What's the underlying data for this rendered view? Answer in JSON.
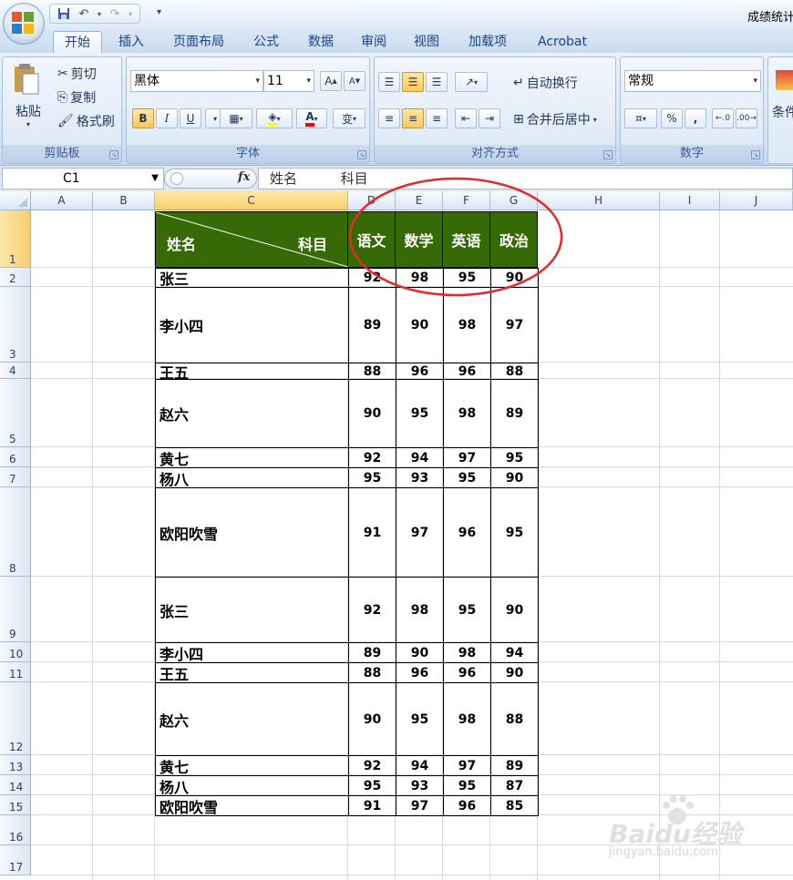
{
  "title_bar": {
    "doc_title": "成绩统计"
  },
  "tabs": [
    "开始",
    "插入",
    "页面布局",
    "公式",
    "数据",
    "审阅",
    "视图",
    "加载项",
    "Acrobat"
  ],
  "ribbon": {
    "clipboard": {
      "label": "剪贴板",
      "paste": "粘贴",
      "cut": "剪切",
      "copy": "复制",
      "format_painter": "格式刷"
    },
    "font": {
      "label": "字体",
      "font_name": "黑体",
      "font_size": "11",
      "bold": "B",
      "italic": "I",
      "underline": "U",
      "phonetic": "变"
    },
    "alignment": {
      "label": "对齐方式",
      "wrap_text": "自动换行",
      "merge_center": "合并后居中"
    },
    "number": {
      "label": "数字",
      "format": "常规",
      "percent": "%",
      "comma": ","
    },
    "styles": {
      "cond_format": "条件"
    }
  },
  "formula_bar": {
    "name_box": "C1",
    "fx": "fx",
    "content": "姓名          科目"
  },
  "columns": [
    "A",
    "B",
    "C",
    "D",
    "E",
    "F",
    "G",
    "H",
    "I",
    "J"
  ],
  "rows": [
    "1",
    "2",
    "3",
    "4",
    "5",
    "6",
    "7",
    "8",
    "9",
    "10",
    "11",
    "12",
    "13",
    "14",
    "15",
    "16",
    "17"
  ],
  "table": {
    "header_name": "姓名",
    "header_subject": "科目",
    "subjects": [
      "语文",
      "数学",
      "英语",
      "政治"
    ],
    "records": [
      {
        "name": "张三",
        "scores": [
          "92",
          "98",
          "95",
          "90"
        ]
      },
      {
        "name": "李小四",
        "scores": [
          "89",
          "90",
          "98",
          "97"
        ]
      },
      {
        "name": "王五",
        "scores": [
          "88",
          "96",
          "96",
          "88"
        ]
      },
      {
        "name": "赵六",
        "scores": [
          "90",
          "95",
          "98",
          "89"
        ]
      },
      {
        "name": "黄七",
        "scores": [
          "92",
          "94",
          "97",
          "95"
        ]
      },
      {
        "name": "杨八",
        "scores": [
          "95",
          "93",
          "95",
          "90"
        ]
      },
      {
        "name": "欧阳吹雪",
        "scores": [
          "91",
          "97",
          "96",
          "95"
        ]
      },
      {
        "name": "张三",
        "scores": [
          "92",
          "98",
          "95",
          "90"
        ]
      },
      {
        "name": "李小四",
        "scores": [
          "89",
          "90",
          "98",
          "94"
        ]
      },
      {
        "name": "王五",
        "scores": [
          "88",
          "96",
          "96",
          "90"
        ]
      },
      {
        "name": "赵六",
        "scores": [
          "90",
          "95",
          "98",
          "88"
        ]
      },
      {
        "name": "黄七",
        "scores": [
          "92",
          "94",
          "97",
          "89"
        ]
      },
      {
        "name": "杨八",
        "scores": [
          "95",
          "93",
          "95",
          "87"
        ]
      },
      {
        "name": "欧阳吹雪",
        "scores": [
          "91",
          "97",
          "96",
          "85"
        ]
      }
    ]
  },
  "watermark": {
    "brand": "Baidu经验",
    "url": "jingyan.baidu.com"
  },
  "colors": {
    "header_fill": "#356a07",
    "annotation_circle": "#e8282b"
  }
}
